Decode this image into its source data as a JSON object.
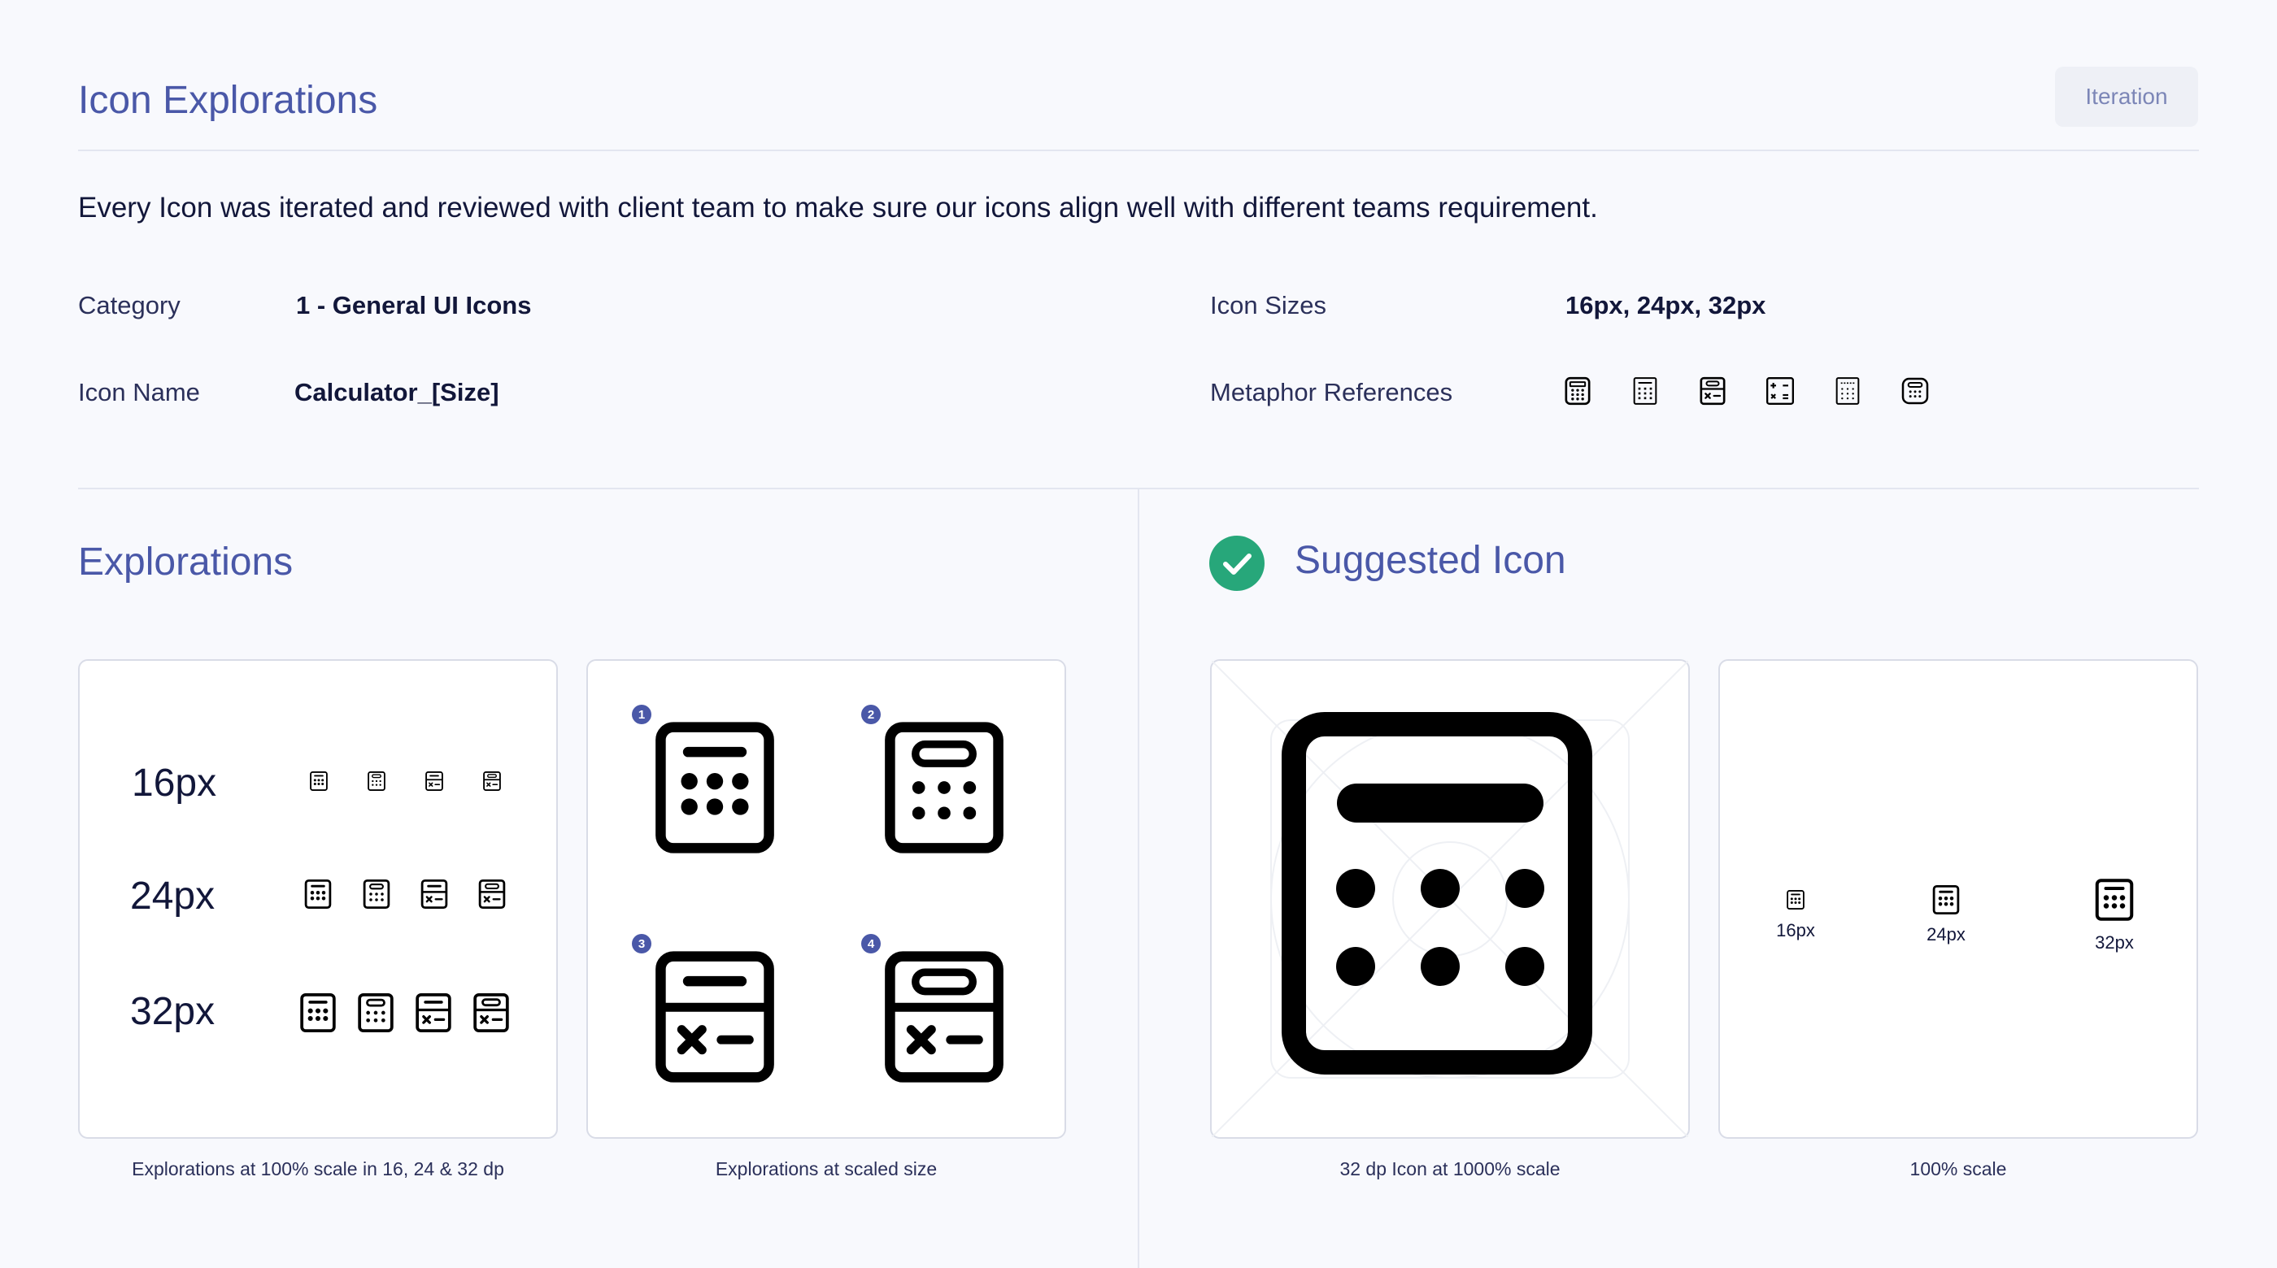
{
  "header": {
    "title": "Icon Explorations",
    "badge": "Iteration",
    "description": "Every Icon was iterated and reviewed with client team to make sure our icons align well with different teams requirement."
  },
  "details": {
    "category_label": "Category",
    "category_value": "1 - General UI Icons",
    "icon_name_label": "Icon Name",
    "icon_name_value": "Calculator_[Size]",
    "icon_sizes_label": "Icon Sizes",
    "icon_sizes_value": "16px, 24px, 32px",
    "metaphor_label": "Metaphor References",
    "metaphor_icons": [
      "calculator-icon",
      "calculator-icon",
      "calculator-icon",
      "calculator-icon",
      "calculator-icon",
      "calculator-icon"
    ]
  },
  "explorations": {
    "title": "Explorations",
    "sizes": [
      "16px",
      "24px",
      "32px"
    ],
    "caption_scale": "Explorations at 100% scale in 16, 24 & 32 dp",
    "variant_numbers": [
      "1",
      "2",
      "3",
      "4"
    ],
    "caption_scaled": "Explorations at scaled size"
  },
  "suggested": {
    "title": "Suggested Icon",
    "caption_large": "32 dp Icon at 1000% scale",
    "size_labels": [
      "16px",
      "24px",
      "32px"
    ],
    "caption_small": "100% scale"
  },
  "colors": {
    "accent": "#4A58A8",
    "success": "#27A77A",
    "background": "#F8F9FD"
  }
}
